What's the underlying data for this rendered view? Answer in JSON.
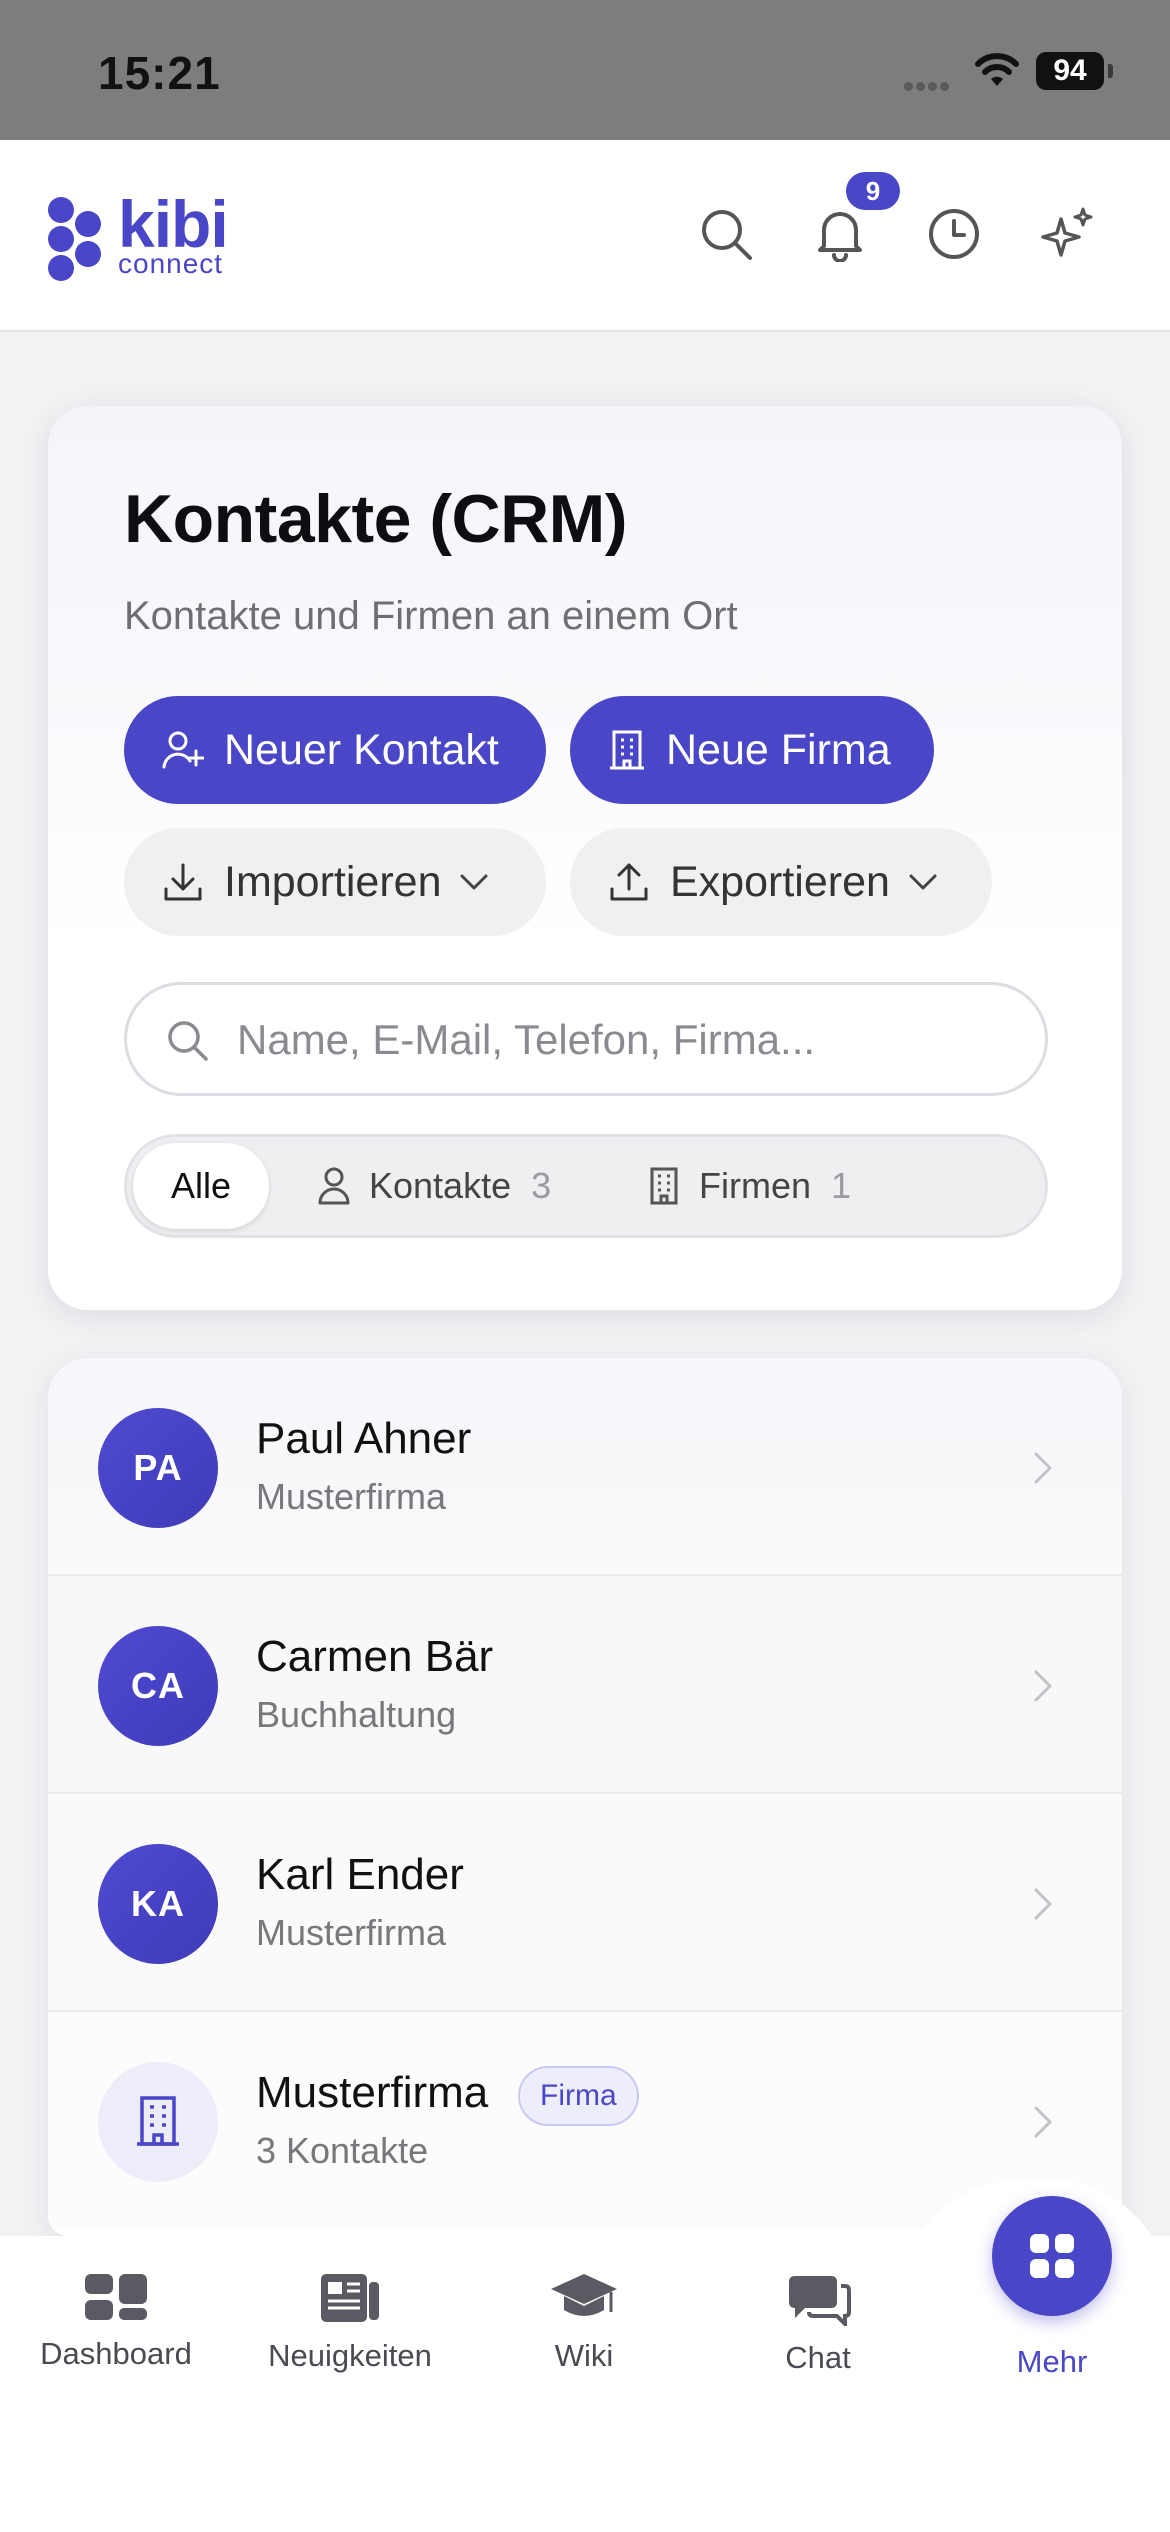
{
  "status_bar": {
    "time": "15:21",
    "battery": "94"
  },
  "header": {
    "logo_word": "kibi",
    "logo_sub": "connect",
    "notification_count": "9",
    "icons": [
      "search-icon",
      "bell-icon",
      "clock-icon",
      "sparkles-icon"
    ]
  },
  "page": {
    "title": "Kontakte (CRM)",
    "subtitle": "Kontakte und Firmen an einem Ort",
    "new_contact_label": "Neuer Kontakt",
    "new_company_label": "Neue Firma",
    "import_label": "Importieren",
    "export_label": "Exportieren",
    "search_placeholder": "Name, E-Mail, Telefon, Firma..."
  },
  "filters": {
    "all_label": "Alle",
    "contacts_label": "Kontakte",
    "contacts_count": "3",
    "companies_label": "Firmen",
    "companies_count": "1",
    "selected": "Alle"
  },
  "contacts": [
    {
      "initials": "PA",
      "name": "Paul Ahner",
      "company": "Musterfirma"
    },
    {
      "initials": "CA",
      "name": "Carmen Bär",
      "company": "Buchhaltung"
    },
    {
      "initials": "KA",
      "name": "Karl Ender",
      "company": "Musterfirma"
    },
    {
      "name": "Musterfirma",
      "tag": "Firma",
      "detail": "3 Kontakte"
    }
  ],
  "bottom_nav": [
    {
      "label": "Dashboard"
    },
    {
      "label": "Neuigkeiten"
    },
    {
      "label": "Wiki"
    },
    {
      "label": "Chat"
    },
    {
      "label": "Mehr",
      "active": true
    }
  ],
  "colors": {
    "accent": "#4a46c8",
    "accent_light": "#ededfa",
    "background": "#f2f2f4"
  }
}
